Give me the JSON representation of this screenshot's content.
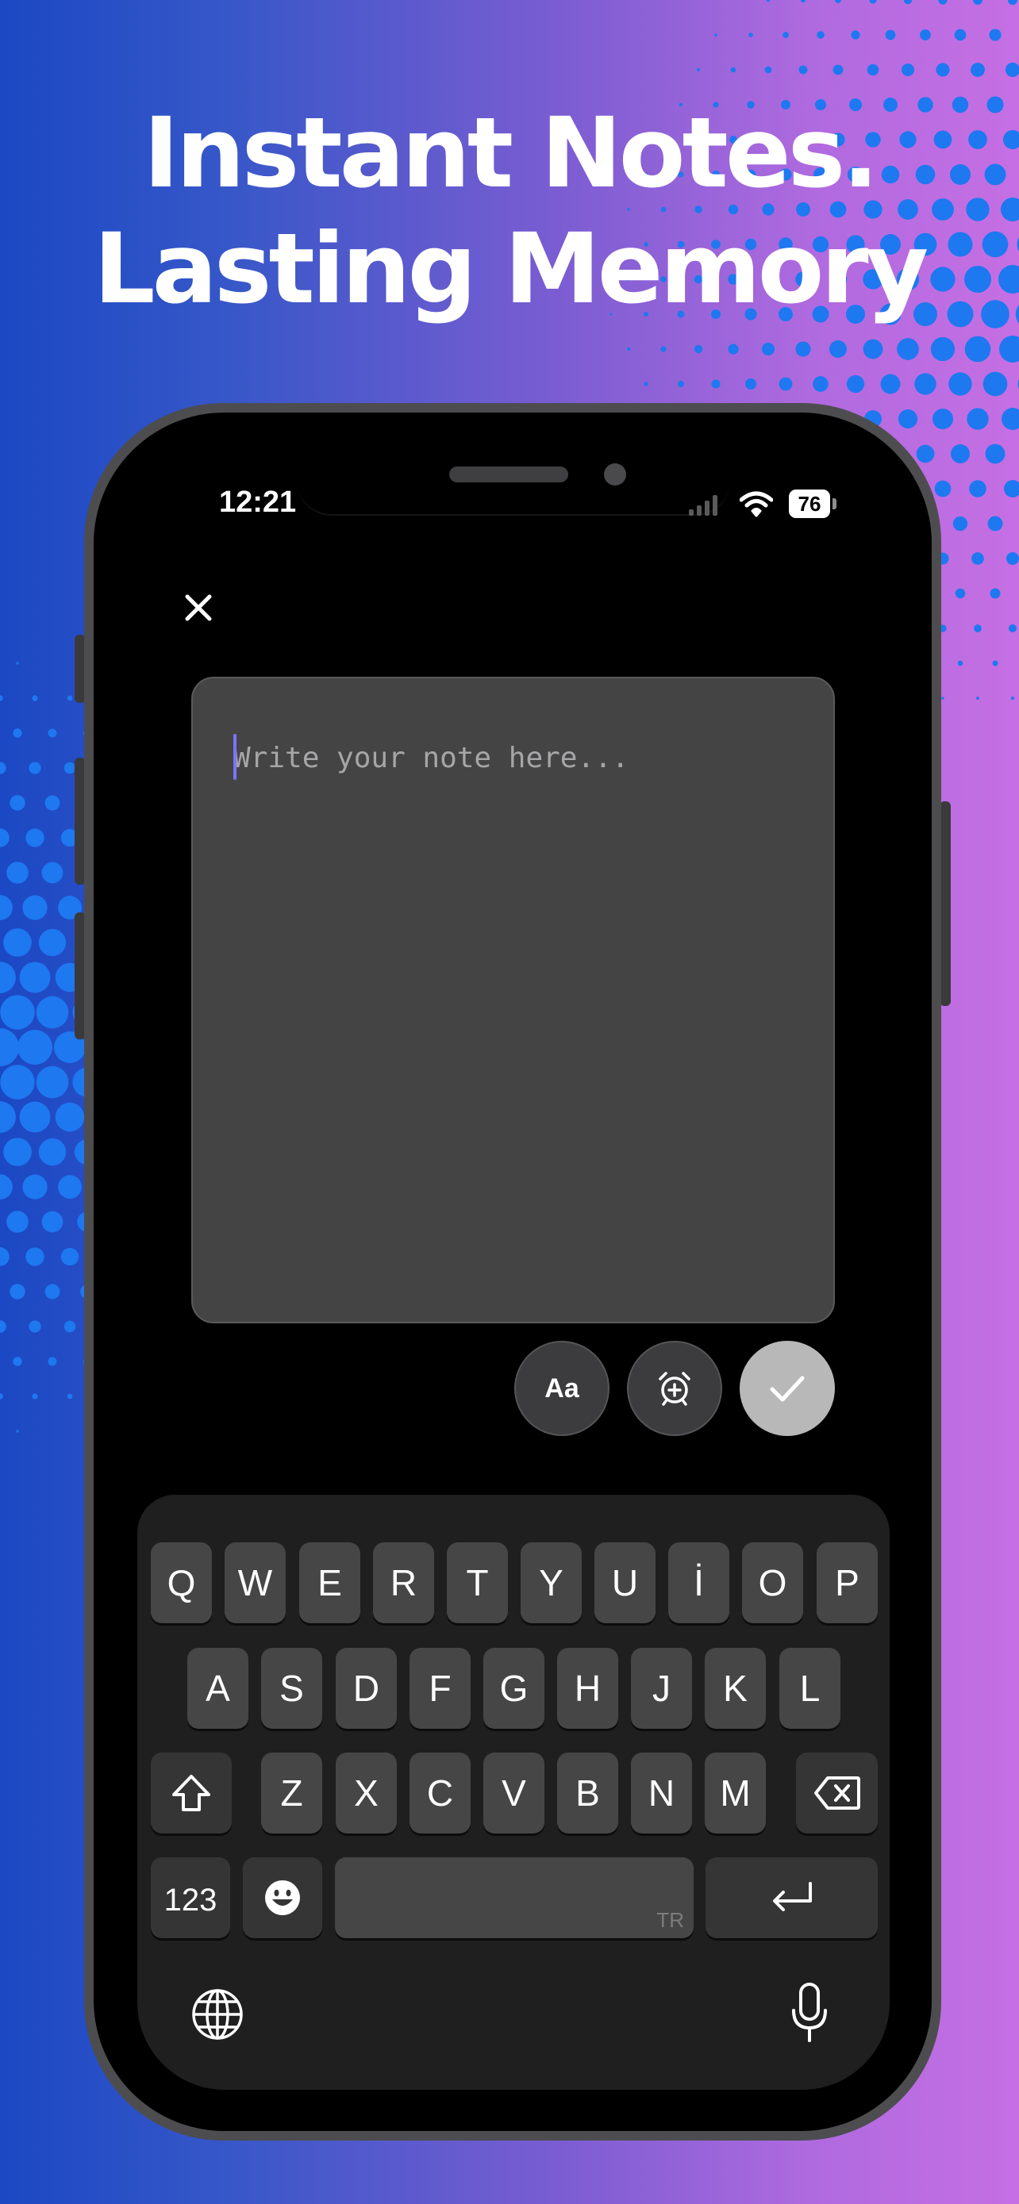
{
  "headline": {
    "line1": "Instant Notes.",
    "line2": "Lasting Memory"
  },
  "status_bar": {
    "time": "12:21",
    "battery": "76"
  },
  "editor": {
    "placeholder": "Write your note here..."
  },
  "actions": {
    "format_label": "Aa"
  },
  "keyboard": {
    "row1": [
      "Q",
      "W",
      "E",
      "R",
      "T",
      "Y",
      "U",
      "İ",
      "O",
      "P"
    ],
    "row2": [
      "A",
      "S",
      "D",
      "F",
      "G",
      "H",
      "J",
      "K",
      "L"
    ],
    "row3": [
      "Z",
      "X",
      "C",
      "V",
      "B",
      "N",
      "M"
    ],
    "numbers_label": "123",
    "space_language": "TR"
  },
  "icons": [
    "close-icon",
    "alarm-add-icon",
    "checkmark-icon",
    "shift-icon",
    "backspace-icon",
    "emoji-icon",
    "return-icon",
    "globe-icon",
    "microphone-icon",
    "wifi-icon",
    "signal-icon"
  ],
  "colors": {
    "background_left": "#1b48c4",
    "background_right": "#c56fe3",
    "dots": "#1e78f0",
    "note_box": "#444444",
    "caret": "#7c74ff",
    "confirm_button": "#b8b8b8"
  }
}
